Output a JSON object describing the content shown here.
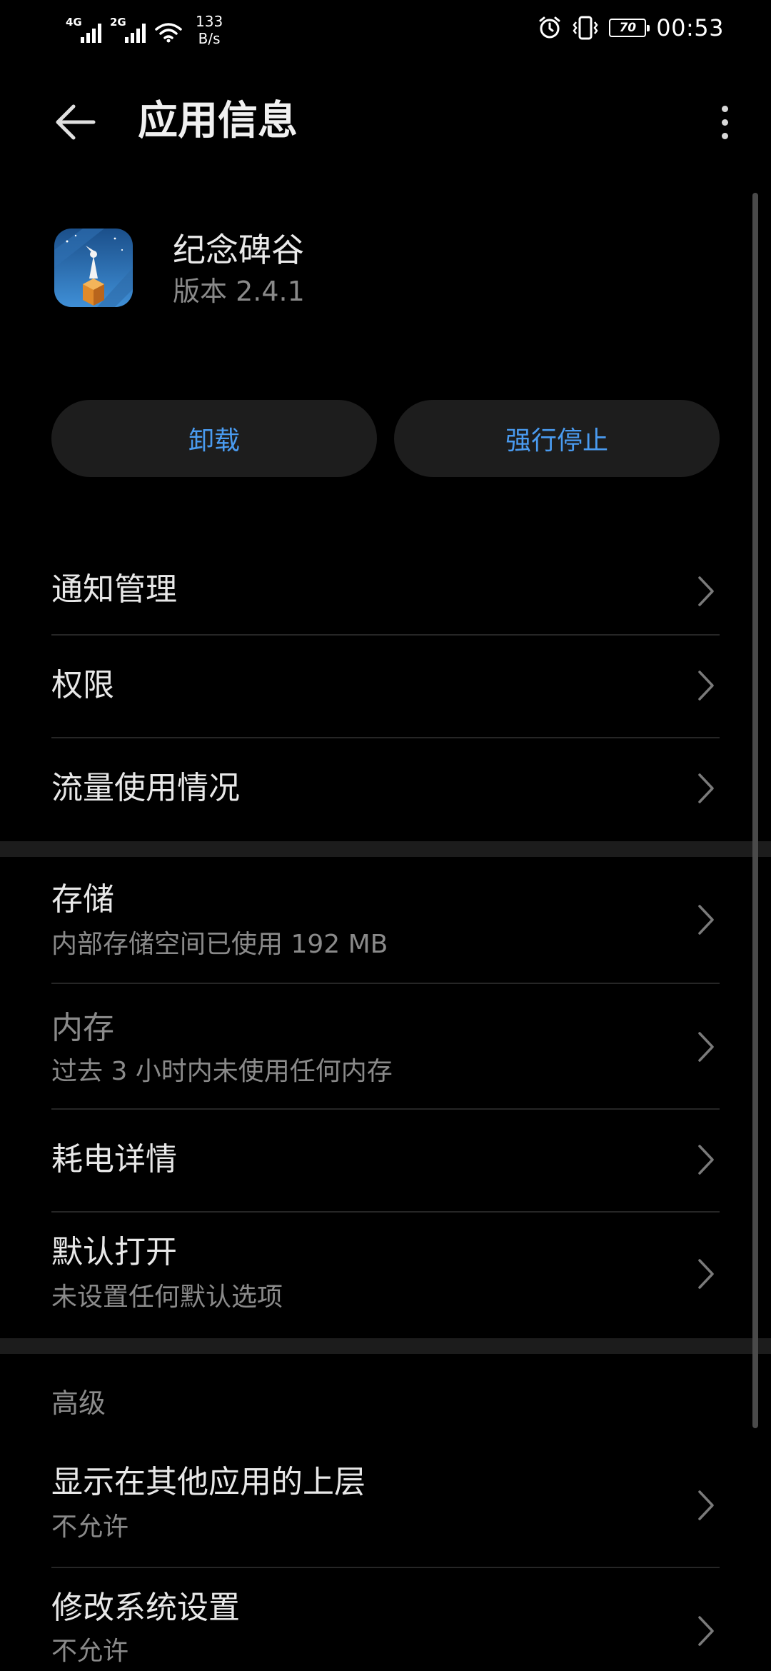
{
  "status_bar": {
    "sim1": "4G",
    "sim2": "2G",
    "net_speed_value": "133",
    "net_speed_unit": "B/s",
    "battery": "70",
    "time": "00:53"
  },
  "app_bar": {
    "title": "应用信息"
  },
  "app": {
    "name": "纪念碑谷",
    "version": "版本 2.4.1"
  },
  "buttons": {
    "uninstall": "卸载",
    "force_stop": "强行停止"
  },
  "section1": {
    "items": [
      {
        "label": "通知管理"
      },
      {
        "label": "权限"
      },
      {
        "label": "流量使用情况"
      }
    ]
  },
  "section2": {
    "items": [
      {
        "label": "存储",
        "sub": "内部存储空间已使用 192 MB"
      },
      {
        "label": "内存",
        "sub": "过去 3 小时内未使用任何内存"
      },
      {
        "label": "耗电详情"
      },
      {
        "label": "默认打开",
        "sub": "未设置任何默认选项"
      }
    ]
  },
  "advanced": {
    "header": "高级",
    "items": [
      {
        "label": "显示在其他应用的上层",
        "sub": "不允许"
      },
      {
        "label": "修改系统设置",
        "sub": "不允许"
      }
    ]
  },
  "colors": {
    "background": "#000000",
    "accent": "#4a9bf0",
    "button_bg": "#1d1d1d",
    "secondary_text": "#8a8a8a"
  }
}
